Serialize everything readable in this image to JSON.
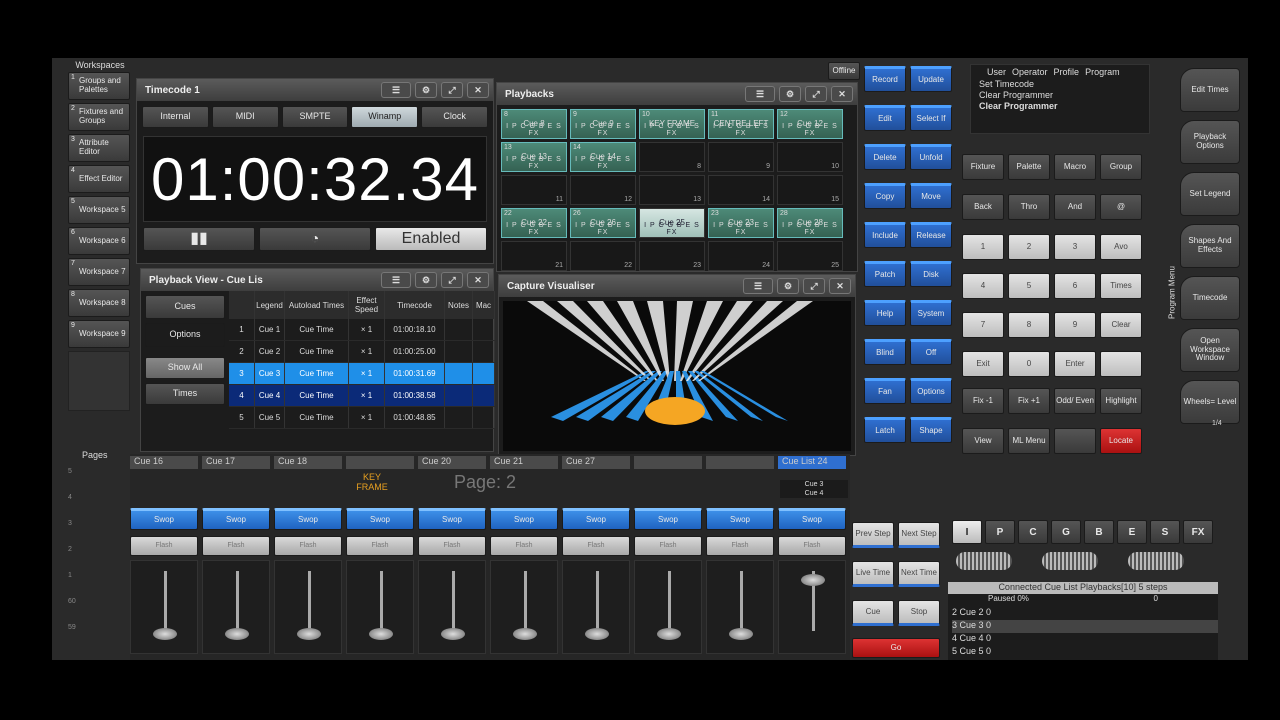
{
  "sidebar": {
    "title": "Workspaces",
    "items": [
      {
        "num": "1",
        "label": "Groups and Palettes"
      },
      {
        "num": "2",
        "label": "Fixtures and Groups"
      },
      {
        "num": "3",
        "label": "Attribute Editor"
      },
      {
        "num": "4",
        "label": "Effect Editor"
      },
      {
        "num": "5",
        "label": "Workspace 5"
      },
      {
        "num": "6",
        "label": "Workspace 6"
      },
      {
        "num": "7",
        "label": "Workspace 7"
      },
      {
        "num": "8",
        "label": "Workspace 8"
      },
      {
        "num": "9",
        "label": "Workspace 9"
      }
    ],
    "pages_label": "Pages"
  },
  "timecode": {
    "title": "Timecode 1",
    "buttons": [
      "Internal",
      "MIDI",
      "SMPTE",
      "Winamp",
      "Clock"
    ],
    "time": "01:00:32.34",
    "enabled": "Enabled"
  },
  "playbacks": {
    "title": "Playbacks",
    "fx": "I P C G B E S FX",
    "row1": [
      {
        "n": "8",
        "name": "Cue 8"
      },
      {
        "n": "9",
        "name": "Cue 9"
      },
      {
        "n": "10",
        "name": "KEY FRAME"
      },
      {
        "n": "11",
        "name": "CENTRE LEFT"
      },
      {
        "n": "12",
        "name": "Cue 12"
      }
    ],
    "row2": [
      {
        "n": "13",
        "name": "Cue 13"
      },
      {
        "n": "14",
        "name": "Cue 14"
      },
      {
        "n": "8"
      },
      {
        "n": "9"
      },
      {
        "n": "10"
      }
    ],
    "row3": [
      "11",
      "12",
      "13",
      "14",
      "15"
    ],
    "row4": [
      {
        "n": "22",
        "name": "Cue 22"
      },
      {
        "n": "26",
        "name": "Cue 26"
      },
      {
        "n": "",
        "name": "Cue 25"
      },
      {
        "n": "23",
        "name": "Cue 23"
      },
      {
        "n": "28",
        "name": "Cue 28"
      }
    ],
    "row5": [
      "21",
      "22",
      "23",
      "24",
      "25"
    ]
  },
  "cuelist": {
    "title": "Playback View - Cue Lis",
    "side": [
      "Cues",
      "Options",
      "Show All",
      "Times"
    ],
    "headers": [
      "",
      "Legend",
      "Autoload Times",
      "Effect Speed",
      "Timecode",
      "Notes",
      "Mac"
    ],
    "rows": [
      {
        "n": "1",
        "legend": "Cue 1",
        "auto": "Cue Time",
        "speed": "× 1",
        "tc": "01:00:18.10"
      },
      {
        "n": "2",
        "legend": "Cue 2",
        "auto": "Cue Time",
        "speed": "× 1",
        "tc": "01:00:25.00"
      },
      {
        "n": "3",
        "legend": "Cue 3",
        "auto": "Cue Time",
        "speed": "× 1",
        "tc": "01:00:31.69"
      },
      {
        "n": "4",
        "legend": "Cue 4",
        "auto": "Cue Time",
        "speed": "× 1",
        "tc": "01:00:38.58"
      },
      {
        "n": "5",
        "legend": "Cue 5",
        "auto": "Cue Time",
        "speed": "× 1",
        "tc": "01:00:48.85"
      }
    ]
  },
  "visualiser": {
    "title": "Capture Visualiser"
  },
  "offline": "Offline",
  "keys": {
    "left": [
      "Record",
      "Update",
      "Edit",
      "Select If",
      "Delete",
      "Unfold",
      "Copy",
      "Move",
      "Include",
      "Release",
      "Patch",
      "Disk",
      "Help",
      "System",
      "Blind",
      "Off",
      "Fan",
      "Options",
      "Latch",
      "Shape"
    ],
    "menu": [
      "User",
      "Operator",
      "Profile",
      "Program"
    ],
    "history": [
      "Set Timecode",
      "Clear Programmer",
      "Clear Programmer"
    ],
    "row1": [
      "Fixture",
      "Palette",
      "Macro",
      "Group"
    ],
    "row2": [
      "Back",
      "Thro",
      "And",
      "@"
    ],
    "num": [
      "1",
      "2",
      "3",
      "Avo",
      "4",
      "5",
      "6",
      "Times",
      "7",
      "8",
      "9",
      "Clear",
      "Exit",
      "0",
      "Enter",
      ""
    ],
    "fix": [
      "Fix -1",
      "Fix +1",
      "Odd/ Even",
      "Highlight"
    ],
    "bottom": [
      "View",
      "ML Menu",
      "",
      "Locate"
    ]
  },
  "rightmenu": {
    "label": "Program Menu",
    "items": [
      "Edit Times",
      "Playback Options",
      "Set Legend",
      "Shapes And Effects",
      "Timecode",
      "Open Workspace Window",
      "Wheels= Level"
    ],
    "page": "1/4"
  },
  "faders": {
    "labels": [
      "Cue 16",
      "Cue 17",
      "Cue 18",
      "",
      "Cue 20",
      "Cue 21",
      "Cue 27",
      "",
      "",
      "Cue List 24"
    ],
    "nums": [
      "16",
      "",
      "18",
      "19",
      "",
      "",
      "27",
      "",
      "",
      "24"
    ],
    "swop": "Swop",
    "flash": "Flash",
    "out": "Out",
    "page": "Page: 2",
    "keyframe": "KEY FRAME",
    "list24": [
      "Cue 3",
      "Cue 4"
    ],
    "scale": [
      "5",
      "4",
      "3",
      "2",
      "1",
      "60",
      "59"
    ],
    "levels": [
      0.05,
      0.05,
      0.05,
      0.05,
      0.05,
      0.05,
      0.05,
      0.05,
      0.05,
      0.95
    ]
  },
  "transport": [
    "Prev Step",
    "Next Step",
    "Live Time",
    "Next Time",
    "Cue",
    "Stop",
    "Go"
  ],
  "attr": [
    "I",
    "P",
    "C",
    "G",
    "B",
    "E",
    "S",
    "FX"
  ],
  "connected": {
    "title": "Connected Cue List Playbacks[10]  5 steps",
    "status": "Paused 0%",
    "zero": "0",
    "rows": [
      "2 Cue 2 0",
      "3 Cue 3 0",
      "4 Cue 4 0",
      "5 Cue 5 0"
    ]
  }
}
